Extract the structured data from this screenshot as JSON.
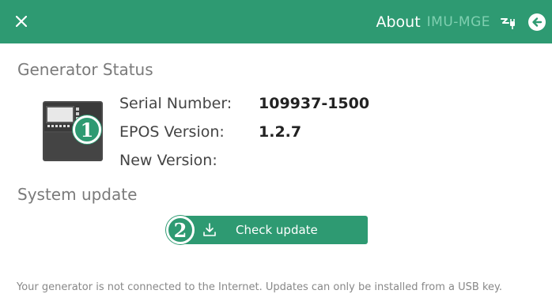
{
  "header": {
    "title": "About",
    "device_name": "IMU-MGE",
    "close_icon": "close-icon",
    "status_icon": "plug-icon",
    "back_icon": "back-arrow-icon",
    "bg_color": "#2e9a72"
  },
  "generator_status": {
    "title": "Generator Status",
    "badge": "1",
    "rows": [
      {
        "label": "Serial Number:",
        "value": "109937-1500"
      },
      {
        "label": "EPOS Version:",
        "value": "1.2.7"
      },
      {
        "label": "New Version:",
        "value": ""
      }
    ]
  },
  "system_update": {
    "title": "System update",
    "badge": "2",
    "button_label": "Check update",
    "button_icon": "download-icon"
  },
  "footer": {
    "message": "Your generator is not connected to the Internet. Updates can only be installed from a USB key."
  }
}
